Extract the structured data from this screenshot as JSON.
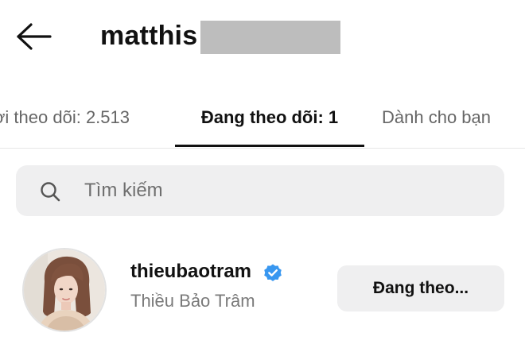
{
  "header": {
    "back_icon": "arrow-left-icon",
    "username": "matthis"
  },
  "tabs": [
    {
      "label": "ời theo dõi: 2.513",
      "active": false
    },
    {
      "label": "Đang theo dõi: 1",
      "active": true
    },
    {
      "label": "Dành cho bạn",
      "active": false
    }
  ],
  "search": {
    "icon": "search-icon",
    "placeholder": "Tìm kiếm",
    "value": ""
  },
  "following_list": [
    {
      "handle": "thieubaotram",
      "verified": true,
      "verified_icon": "verified-badge-icon",
      "full_name": "Thiều Bảo Trâm",
      "button_label": "Đang theo..."
    }
  ],
  "colors": {
    "text_primary": "#111111",
    "text_secondary": "#7a7a7a",
    "search_bg": "#efeff0",
    "button_bg": "#efeff0",
    "verified_blue": "#3897f0",
    "redaction": "#bdbdbd"
  }
}
